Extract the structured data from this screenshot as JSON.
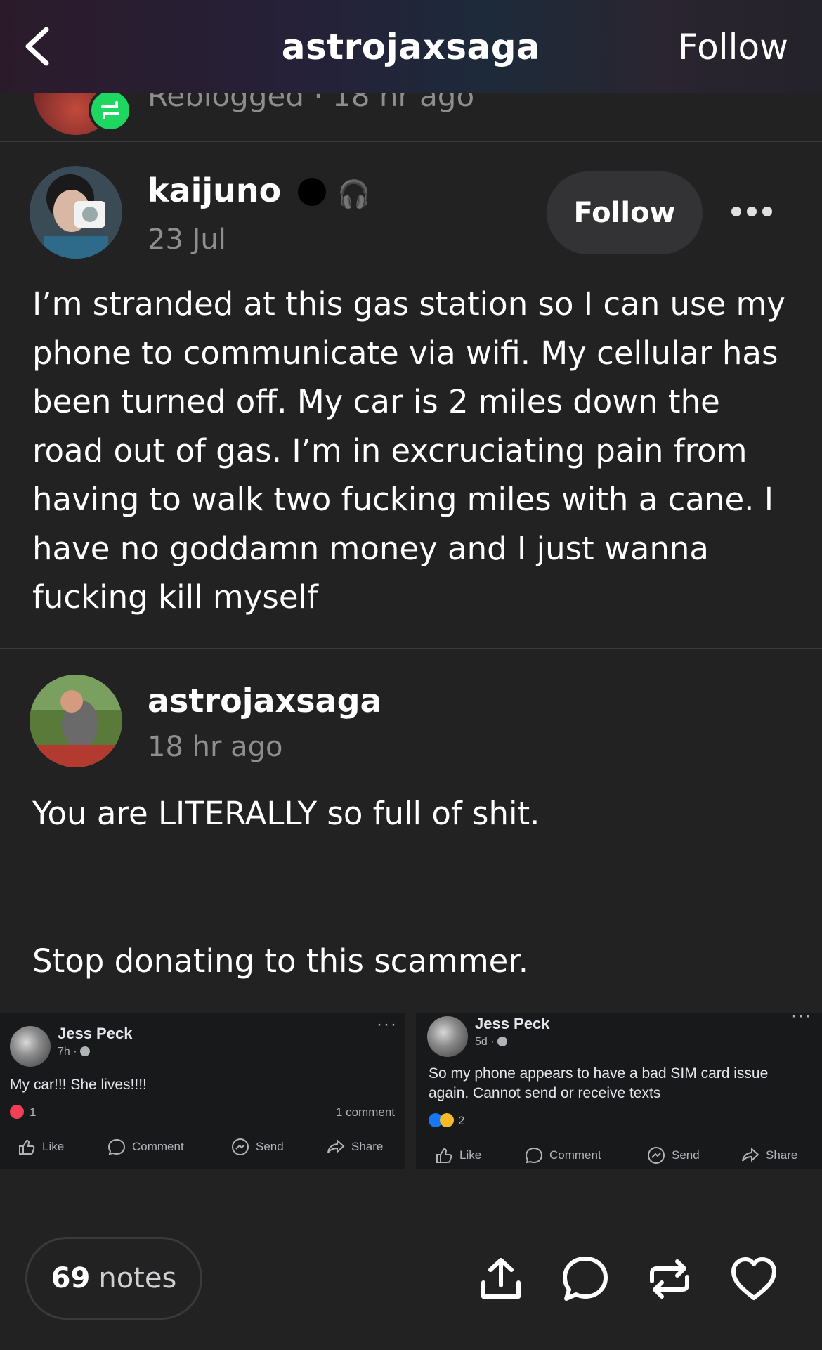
{
  "header": {
    "title": "astrojaxsaga",
    "follow_label": "Follow"
  },
  "reblog_strip": {
    "text": "Reblogged · 18 hr ago"
  },
  "original_post": {
    "username": "kaijuno",
    "date": "23 Jul",
    "badge_emoji": "🎧",
    "follow_label": "Follow",
    "body": "I’m stranded at this gas station so I can use my phone to communicate via wifi. My cellular has been turned off. My car is 2 miles down the road out of gas. I’m in excruciating pain from having to walk two fucking miles with a cane. I have no goddamn money and I just wanna fucking kill myself"
  },
  "reblog_post": {
    "username": "astrojaxsaga",
    "date": "18 hr ago",
    "paragraph_1": "You are LITERALLY so full of shit.",
    "paragraph_2": "Stop donating to this scammer."
  },
  "screenshots": [
    {
      "name": "Jess Peck",
      "meta": "7h ·",
      "text": "My car!!! She lives!!!!",
      "reaction_count": "1",
      "comments": "1 comment",
      "reaction_color": "#f33e58",
      "actions": [
        "Like",
        "Comment",
        "Send",
        "Share"
      ]
    },
    {
      "name": "Jess Peck",
      "meta": "5d ·",
      "text": "So my phone appears to have a bad SIM card issue again. Cannot send or receive texts",
      "reaction_count": "2",
      "reaction_colors": [
        "#1877f2",
        "#f7b928"
      ],
      "actions": [
        "Like",
        "Comment",
        "Send",
        "Share"
      ]
    }
  ],
  "footer": {
    "notes_count": "69",
    "notes_label": "notes"
  },
  "icons": {
    "back": "chevron-left-icon",
    "more": "more-dots-icon",
    "share": "share-icon",
    "comment": "comment-icon",
    "reblog": "reblog-icon",
    "like": "heart-icon"
  }
}
